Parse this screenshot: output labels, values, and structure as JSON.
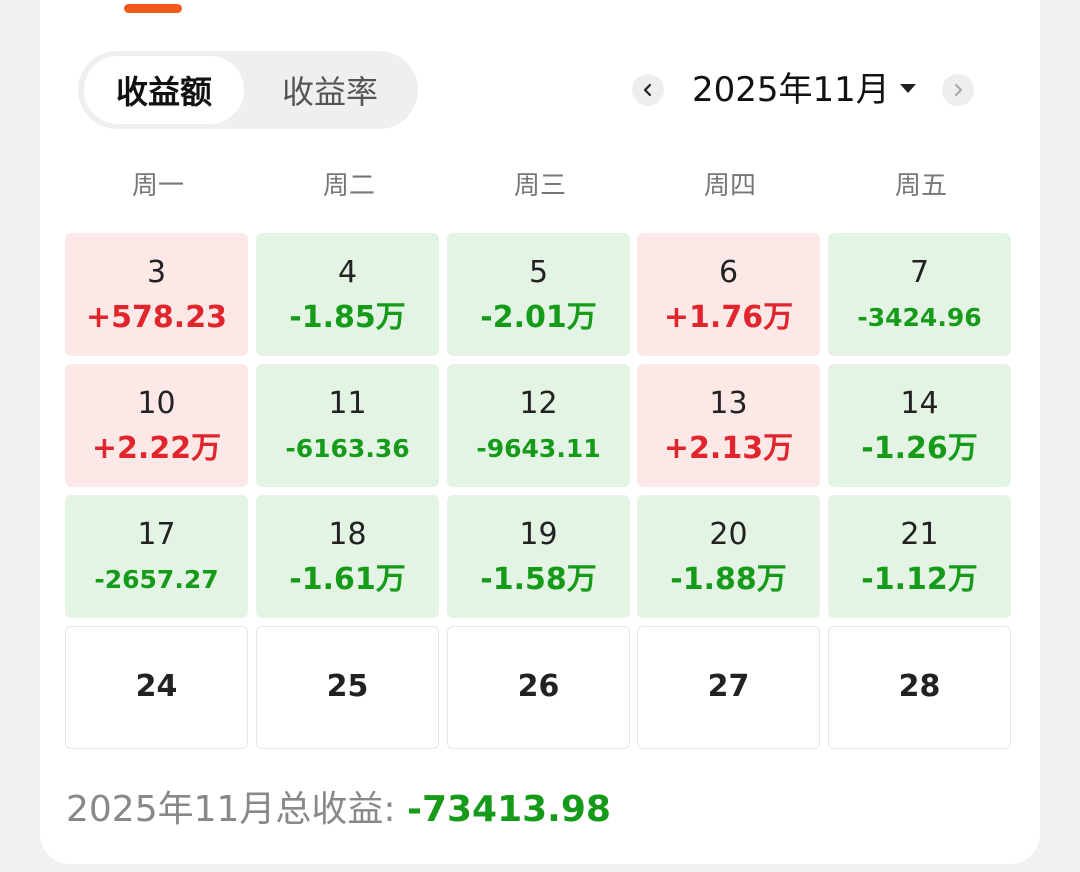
{
  "tabs": {
    "active_label": "收益额",
    "inactive_label": "收益率"
  },
  "month_nav": {
    "label": "2025年11月",
    "prev_icon": "chevron-left-icon",
    "next_icon": "chevron-right-icon",
    "dropdown_icon": "caret-down-icon"
  },
  "weekdays": [
    "周一",
    "周二",
    "周三",
    "周四",
    "周五"
  ],
  "colors": {
    "gain_bg": "#fde8e8",
    "loss_bg": "#e4f4e4",
    "gain_text": "#e0262c",
    "loss_text": "#169a1a",
    "accent": "#f05a1a"
  },
  "calendar": {
    "weeks": [
      [
        {
          "day": "3",
          "value": "+578.23",
          "trend": "up"
        },
        {
          "day": "4",
          "value": "-1.85万",
          "trend": "down"
        },
        {
          "day": "5",
          "value": "-2.01万",
          "trend": "down"
        },
        {
          "day": "6",
          "value": "+1.76万",
          "trend": "up"
        },
        {
          "day": "7",
          "value": "-3424.96",
          "trend": "down"
        }
      ],
      [
        {
          "day": "10",
          "value": "+2.22万",
          "trend": "up"
        },
        {
          "day": "11",
          "value": "-6163.36",
          "trend": "down"
        },
        {
          "day": "12",
          "value": "-9643.11",
          "trend": "down"
        },
        {
          "day": "13",
          "value": "+2.13万",
          "trend": "up"
        },
        {
          "day": "14",
          "value": "-1.26万",
          "trend": "down"
        }
      ],
      [
        {
          "day": "17",
          "value": "-2657.27",
          "trend": "down"
        },
        {
          "day": "18",
          "value": "-1.61万",
          "trend": "down"
        },
        {
          "day": "19",
          "value": "-1.58万",
          "trend": "down"
        },
        {
          "day": "20",
          "value": "-1.88万",
          "trend": "down"
        },
        {
          "day": "21",
          "value": "-1.12万",
          "trend": "down"
        }
      ],
      [
        {
          "day": "24",
          "value": "",
          "trend": "none"
        },
        {
          "day": "25",
          "value": "",
          "trend": "none"
        },
        {
          "day": "26",
          "value": "",
          "trend": "none"
        },
        {
          "day": "27",
          "value": "",
          "trend": "none"
        },
        {
          "day": "28",
          "value": "",
          "trend": "none"
        }
      ]
    ]
  },
  "summary": {
    "label": "2025年11月总收益: ",
    "value": "-73413.98"
  }
}
